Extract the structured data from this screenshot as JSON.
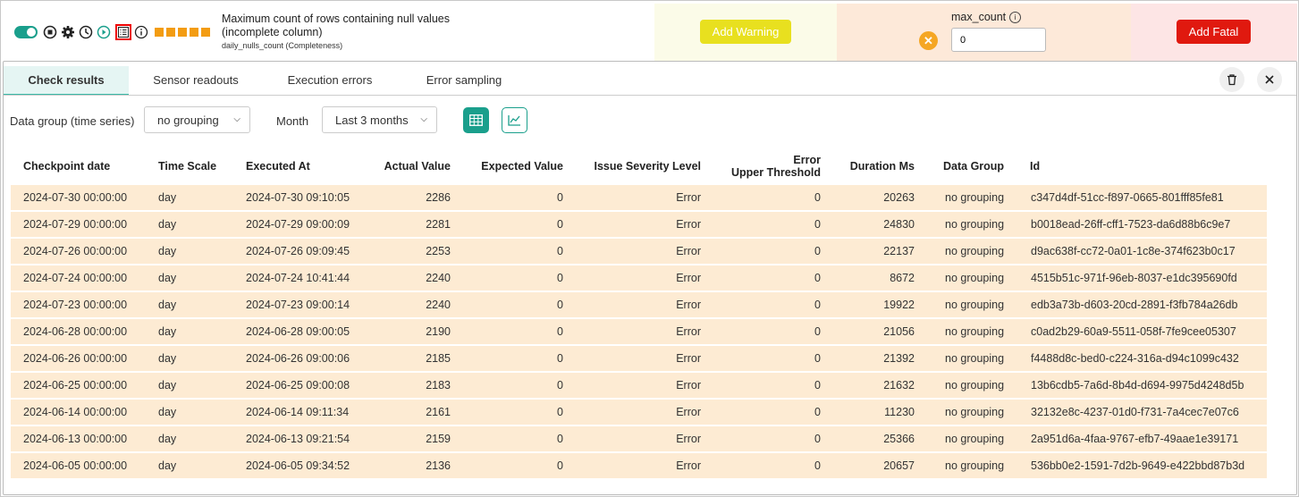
{
  "check": {
    "title": "Maximum count of rows containing null values (incomplete column)",
    "subtitle": "daily_nulls_count (Completeness)",
    "bar_color": "#f39c12"
  },
  "rule": {
    "warning_label": "Add Warning",
    "fatal_label": "Add Fatal",
    "param_label": "max_count",
    "param_value": "0",
    "error_close": "✕"
  },
  "tabs": [
    {
      "label": "Check results",
      "active": true
    },
    {
      "label": "Sensor readouts",
      "active": false
    },
    {
      "label": "Execution errors",
      "active": false
    },
    {
      "label": "Error sampling",
      "active": false
    }
  ],
  "filters": {
    "group_label": "Data group (time series)",
    "group_value": "no grouping",
    "month_label": "Month",
    "month_value": "Last 3 months"
  },
  "columns": [
    "Checkpoint date",
    "Time Scale",
    "Executed At",
    "Actual Value",
    "Expected Value",
    "Issue Severity Level",
    "Error",
    "Upper Threshold",
    "Duration Ms",
    "Data Group",
    "Id"
  ],
  "rows": [
    [
      "2024-07-30 00:00:00",
      "day",
      "2024-07-30 09:10:05",
      "2286",
      "0",
      "Error",
      "0",
      "20263",
      "no grouping",
      "c347d4df-51cc-f897-0665-801fff85fe81"
    ],
    [
      "2024-07-29 00:00:00",
      "day",
      "2024-07-29 09:00:09",
      "2281",
      "0",
      "Error",
      "0",
      "24830",
      "no grouping",
      "b0018ead-26ff-cff1-7523-da6d88b6c9e7"
    ],
    [
      "2024-07-26 00:00:00",
      "day",
      "2024-07-26 09:09:45",
      "2253",
      "0",
      "Error",
      "0",
      "22137",
      "no grouping",
      "d9ac638f-cc72-0a01-1c8e-374f623b0c17"
    ],
    [
      "2024-07-24 00:00:00",
      "day",
      "2024-07-24 10:41:44",
      "2240",
      "0",
      "Error",
      "0",
      "8672",
      "no grouping",
      "4515b51c-971f-96eb-8037-e1dc395690fd"
    ],
    [
      "2024-07-23 00:00:00",
      "day",
      "2024-07-23 09:00:14",
      "2240",
      "0",
      "Error",
      "0",
      "19922",
      "no grouping",
      "edb3a73b-d603-20cd-2891-f3fb784a26db"
    ],
    [
      "2024-06-28 00:00:00",
      "day",
      "2024-06-28 09:00:05",
      "2190",
      "0",
      "Error",
      "0",
      "21056",
      "no grouping",
      "c0ad2b29-60a9-5511-058f-7fe9cee05307"
    ],
    [
      "2024-06-26 00:00:00",
      "day",
      "2024-06-26 09:00:06",
      "2185",
      "0",
      "Error",
      "0",
      "21392",
      "no grouping",
      "f4488d8c-bed0-c224-316a-d94c1099c432"
    ],
    [
      "2024-06-25 00:00:00",
      "day",
      "2024-06-25 09:00:08",
      "2183",
      "0",
      "Error",
      "0",
      "21632",
      "no grouping",
      "13b6cdb5-7a6d-8b4d-d694-9975d4248d5b"
    ],
    [
      "2024-06-14 00:00:00",
      "day",
      "2024-06-14 09:11:34",
      "2161",
      "0",
      "Error",
      "0",
      "11230",
      "no grouping",
      "32132e8c-4237-01d0-f731-7a4cec7e07c6"
    ],
    [
      "2024-06-13 00:00:00",
      "day",
      "2024-06-13 09:21:54",
      "2159",
      "0",
      "Error",
      "0",
      "25366",
      "no grouping",
      "2a951d6a-4faa-9767-efb7-49aae1e39171"
    ],
    [
      "2024-06-05 00:00:00",
      "day",
      "2024-06-05 09:34:52",
      "2136",
      "0",
      "Error",
      "0",
      "20657",
      "no grouping",
      "536bb0e2-1591-7d2b-9649-e422bbd87b3d"
    ]
  ]
}
